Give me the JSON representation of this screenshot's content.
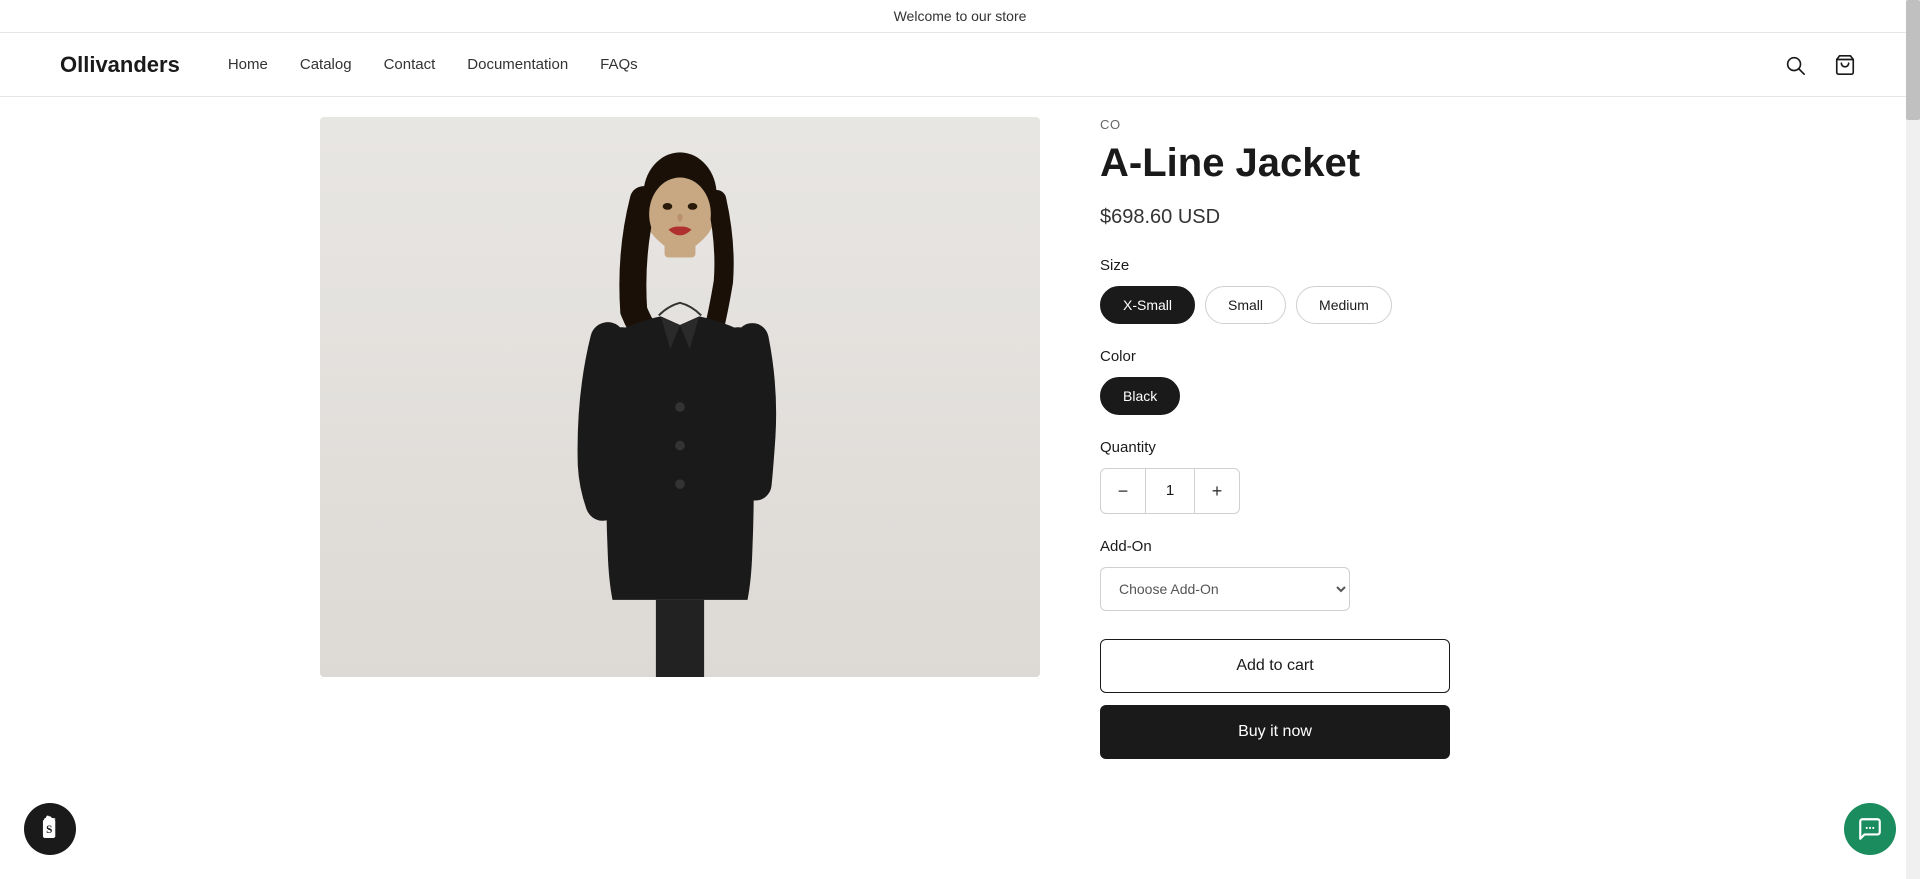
{
  "announcement": {
    "text": "Welcome to our store"
  },
  "header": {
    "logo": "Ollivanders",
    "nav": [
      {
        "label": "Home",
        "href": "#"
      },
      {
        "label": "Catalog",
        "href": "#"
      },
      {
        "label": "Contact",
        "href": "#"
      },
      {
        "label": "Documentation",
        "href": "#"
      },
      {
        "label": "FAQs",
        "href": "#"
      }
    ]
  },
  "product": {
    "vendor": "CO",
    "title": "A-Line Jacket",
    "price": "$698.60 USD",
    "size_label": "Size",
    "sizes": [
      {
        "label": "X-Small",
        "active": true
      },
      {
        "label": "Small",
        "active": false
      },
      {
        "label": "Medium",
        "active": false
      }
    ],
    "color_label": "Color",
    "colors": [
      {
        "label": "Black",
        "active": true
      }
    ],
    "quantity_label": "Quantity",
    "quantity": "1",
    "addon_label": "Add-On",
    "addon_placeholder": "Choose Add-On",
    "addon_options": [
      "Choose Add-On"
    ],
    "add_to_cart_label": "Add to cart",
    "buy_now_label": "Buy it now"
  },
  "icons": {
    "search": "🔍",
    "cart": "🛍",
    "shopify": "S",
    "chat": "💬",
    "minus": "−",
    "plus": "+"
  }
}
